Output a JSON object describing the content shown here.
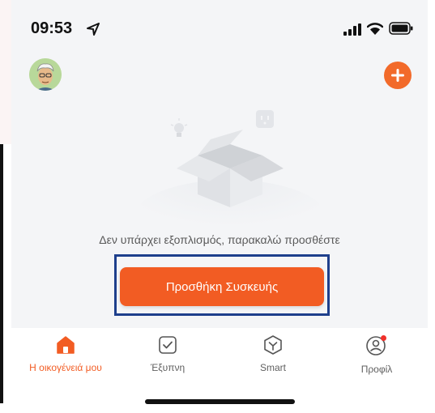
{
  "status_bar": {
    "time": "09:53",
    "icons": [
      "location-arrow-icon",
      "signal-icon",
      "wifi-icon",
      "battery-icon"
    ]
  },
  "header": {
    "avatar": "avatar",
    "add_icon": "plus-icon"
  },
  "empty_state": {
    "message": "Δεν υπάρχει εξοπλισμός, παρακαλώ προσθέστε",
    "button_label": "Προσθήκη Συσκευής"
  },
  "tab_bar": {
    "tabs": [
      {
        "label": "Η οικογένειά μου",
        "icon": "home-icon",
        "active": true
      },
      {
        "label": "Έξυπνη",
        "icon": "checkbox-icon",
        "active": false
      },
      {
        "label": "Smart",
        "icon": "hexagon-icon",
        "active": false
      },
      {
        "label": "Προφίλ",
        "icon": "profile-icon",
        "active": false,
        "badge": true
      }
    ]
  },
  "colors": {
    "accent": "#f25c23",
    "background": "#f4f5f7",
    "highlight_box": "#1e3f8c",
    "text": "#5a5a5a"
  }
}
